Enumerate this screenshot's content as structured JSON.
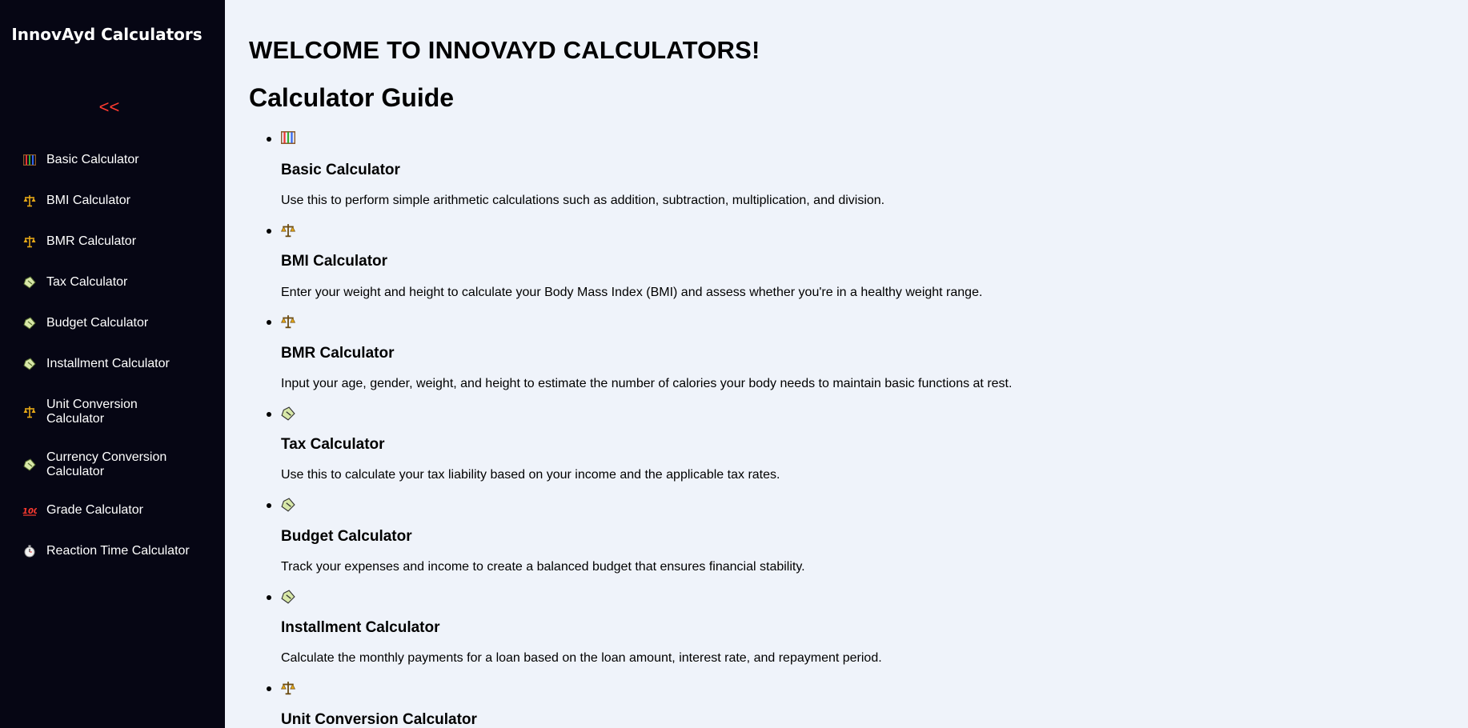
{
  "sidebar": {
    "brand": "InnovAyd Calculators",
    "collapse_label": "<<",
    "items": [
      {
        "label": "Basic Calculator",
        "icon": "abacus-icon"
      },
      {
        "label": "BMI Calculator",
        "icon": "scales-icon"
      },
      {
        "label": "BMR Calculator",
        "icon": "scales-icon"
      },
      {
        "label": "Tax Calculator",
        "icon": "money-bag-icon"
      },
      {
        "label": "Budget Calculator",
        "icon": "money-bag-icon"
      },
      {
        "label": "Installment Calculator",
        "icon": "money-bag-icon"
      },
      {
        "label": "Unit Conversion Calculator",
        "icon": "scales-icon"
      },
      {
        "label": "Currency Conversion Calculator",
        "icon": "money-bag-icon"
      },
      {
        "label": "Grade Calculator",
        "icon": "hundred-points-icon"
      },
      {
        "label": "Reaction Time Calculator",
        "icon": "stopwatch-icon"
      }
    ]
  },
  "main": {
    "welcome": "WELCOME TO INNOVAYD CALCULATORS!",
    "guide_title": "Calculator Guide",
    "entries": [
      {
        "title": "Basic Calculator",
        "icon": "abacus-icon",
        "description": "Use this to perform simple arithmetic calculations such as addition, subtraction, multiplication, and division."
      },
      {
        "title": "BMI Calculator",
        "icon": "scales-icon",
        "description": "Enter your weight and height to calculate your Body Mass Index (BMI) and assess whether you're in a healthy weight range."
      },
      {
        "title": "BMR Calculator",
        "icon": "scales-icon",
        "description": "Input your age, gender, weight, and height to estimate the number of calories your body needs to maintain basic functions at rest."
      },
      {
        "title": "Tax Calculator",
        "icon": "money-bag-icon",
        "description": "Use this to calculate your tax liability based on your income and the applicable tax rates."
      },
      {
        "title": "Budget Calculator",
        "icon": "money-bag-icon",
        "description": "Track your expenses and income to create a balanced budget that ensures financial stability."
      },
      {
        "title": "Installment Calculator",
        "icon": "money-bag-icon",
        "description": "Calculate the monthly payments for a loan based on the loan amount, interest rate, and repayment period."
      },
      {
        "title": "Unit Conversion Calculator",
        "icon": "scales-icon",
        "description": ""
      }
    ]
  },
  "colors": {
    "sidebar_bg": "#060614",
    "page_bg": "#eff3fa",
    "collapse_accent": "#ff3b30"
  }
}
